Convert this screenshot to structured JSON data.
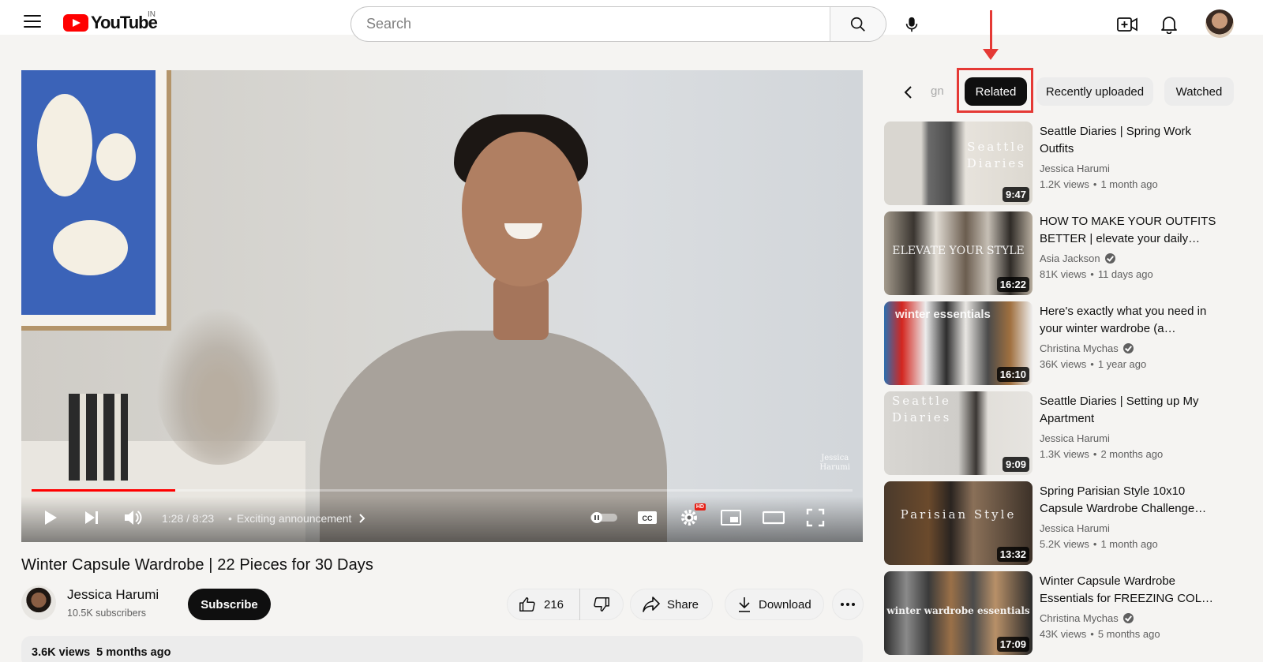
{
  "header": {
    "logo_text": "YouTube",
    "region": "IN",
    "search_placeholder": "Search"
  },
  "player": {
    "current_time": "1:28",
    "duration": "8:23",
    "time_display": "1:28 / 8:23",
    "chapter": "Exciting announcement",
    "watermark_line1": "Jessica",
    "watermark_line2": "Harumi",
    "hd_badge": "HD",
    "progress_fraction": 0.175
  },
  "video": {
    "title": "Winter Capsule Wardrobe | 22 Pieces for 30 Days",
    "channel_name": "Jessica Harumi",
    "subscribers": "10.5K subscribers",
    "subscribe_label": "Subscribe",
    "like_count": "216",
    "share_label": "Share",
    "download_label": "Download",
    "views": "3.6K views",
    "uploaded": "5 months ago"
  },
  "chips": {
    "fragment": "gn",
    "items": [
      "Related",
      "Recently uploaded",
      "Watched"
    ],
    "active": "Related"
  },
  "related": [
    {
      "title": "Seattle Diaries | Spring Work Outfits",
      "channel": "Jessica Harumi",
      "verified": false,
      "views": "1.2K views",
      "age": "1 month ago",
      "duration": "9:47",
      "thumb_text": "Seattle\nDiaries"
    },
    {
      "title": "HOW TO MAKE YOUR OUTFITS BETTER | elevate your daily…",
      "channel": "Asia Jackson",
      "verified": true,
      "views": "81K views",
      "age": "11 days ago",
      "duration": "16:22",
      "thumb_text": "ELEVATE YOUR STYLE"
    },
    {
      "title": "Here's exactly what you need in your winter wardrobe (a…",
      "channel": "Christina Mychas",
      "verified": true,
      "views": "36K views",
      "age": "1 year ago",
      "duration": "16:10",
      "thumb_text": "winter essentials"
    },
    {
      "title": "Seattle Diaries | Setting up My Apartment",
      "channel": "Jessica Harumi",
      "verified": false,
      "views": "1.3K views",
      "age": "2 months ago",
      "duration": "9:09",
      "thumb_text": "Seattle\nDiaries"
    },
    {
      "title": "Spring Parisian Style 10x10 Capsule Wardrobe Challenge…",
      "channel": "Jessica Harumi",
      "verified": false,
      "views": "5.2K views",
      "age": "1 month ago",
      "duration": "13:32",
      "thumb_text": "Parisian Style"
    },
    {
      "title": "Winter Capsule Wardrobe Essentials for FREEZING COL…",
      "channel": "Christina Mychas",
      "verified": true,
      "views": "43K views",
      "age": "5 months ago",
      "duration": "17:09",
      "thumb_text": "winter wardrobe essentials"
    }
  ],
  "colors": {
    "brand_red": "#ff0000",
    "annotation_red": "#e53935",
    "text_primary": "#0f0f0f",
    "text_secondary": "#606060"
  }
}
